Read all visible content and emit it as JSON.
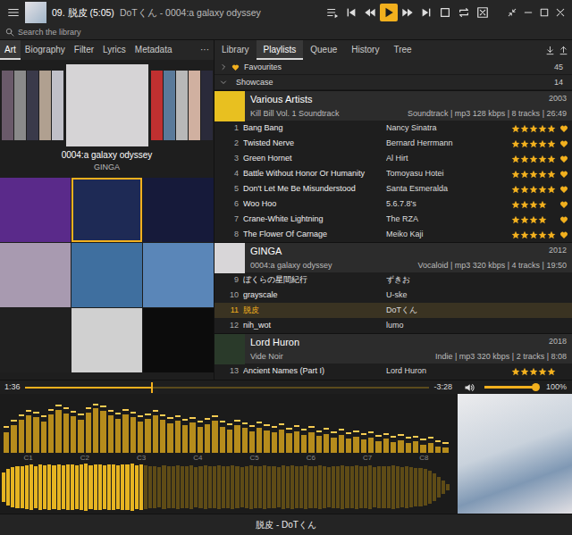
{
  "window": {
    "title": "09. 脱皮 (5:05)",
    "subtitle": "DoTくん - 0004:a galaxy odyssey"
  },
  "transport": [
    {
      "kind": "playlist",
      "selected": false
    },
    {
      "kind": "prev",
      "selected": false
    },
    {
      "kind": "rewind",
      "selected": false
    },
    {
      "kind": "play",
      "selected": true
    },
    {
      "kind": "forward",
      "selected": false
    },
    {
      "kind": "next",
      "selected": false
    },
    {
      "kind": "stop",
      "selected": false
    },
    {
      "kind": "repeat",
      "selected": false
    },
    {
      "kind": "shuffle",
      "selected": false
    }
  ],
  "window_controls": [
    {
      "kind": "mini"
    },
    {
      "kind": "minimize"
    },
    {
      "kind": "maximize"
    },
    {
      "kind": "close"
    }
  ],
  "search": {
    "placeholder": "Search the library"
  },
  "left_tabs": {
    "items": [
      {
        "label": "Art",
        "selected": true
      },
      {
        "label": "Biography",
        "selected": false
      },
      {
        "label": "Filter",
        "selected": false
      },
      {
        "label": "Lyrics",
        "selected": false
      },
      {
        "label": "Metadata",
        "selected": false
      }
    ],
    "more": "···"
  },
  "coverflow": {
    "covers": [
      {
        "color": "#6a5a6a",
        "selected": false
      },
      {
        "color": "#8a8a8a",
        "selected": false
      },
      {
        "color": "#3a3a4a",
        "selected": false
      },
      {
        "color": "#b0a090",
        "selected": false
      },
      {
        "color": "#c0c0c8",
        "selected": false
      },
      {
        "color": "#d6d4d6",
        "selected": true
      },
      {
        "color": "#c03030",
        "selected": false
      },
      {
        "color": "#5a7a9a",
        "selected": false
      },
      {
        "color": "#b8b8b8",
        "selected": false
      },
      {
        "color": "#d0b0a0",
        "selected": false
      },
      {
        "color": "#2a2a3a",
        "selected": false
      }
    ],
    "title": "0004:a galaxy odyssey",
    "artist": "GINGA"
  },
  "album_grid": [
    {
      "color": "#5a2a8a",
      "selected": false
    },
    {
      "color": "#1e2a55",
      "selected": true
    },
    {
      "color": "#161a3a",
      "selected": false
    },
    {
      "color": "#a89ab0",
      "selected": false
    },
    {
      "color": "#3f6f9f",
      "selected": false
    },
    {
      "color": "#5a86b8",
      "selected": false
    },
    {
      "color": "#202020",
      "selected": false
    },
    {
      "color": "#d0d0d0",
      "selected": false
    },
    {
      "color": "#0c0c0c",
      "selected": false
    }
  ],
  "right_tabs": [
    {
      "label": "Library",
      "selected": false
    },
    {
      "label": "Playlists",
      "selected": true
    },
    {
      "label": "Queue",
      "selected": false
    },
    {
      "label": "History",
      "selected": false
    },
    {
      "label": "Tree",
      "selected": false
    }
  ],
  "playlists": [
    {
      "name": "Favourites",
      "count": "45",
      "expanded": false,
      "favourite": true
    },
    {
      "name": "Showcase",
      "count": "14",
      "expanded": true,
      "favourite": false
    }
  ],
  "groups": [
    {
      "artist": "Various Artists",
      "album": "Kill Bill Vol. 1 Soundtrack",
      "year": "2003",
      "info": "Soundtrack | mp3 128 kbps | 8 tracks | 26:49",
      "color": "#e8c020",
      "tracks": [
        {
          "no": "1",
          "title": "Bang Bang",
          "artist": "Nancy Sinatra",
          "stars": 5,
          "loved": true,
          "selected": false
        },
        {
          "no": "2",
          "title": "Twisted Nerve",
          "artist": "Bernard Herrmann",
          "stars": 5,
          "loved": true,
          "selected": false
        },
        {
          "no": "3",
          "title": "Green Hornet",
          "artist": "Al Hirt",
          "stars": 5,
          "loved": true,
          "selected": false
        },
        {
          "no": "4",
          "title": "Battle Without Honor Or Humanity",
          "artist": "Tomoyasu Hotei",
          "stars": 5,
          "loved": true,
          "selected": false
        },
        {
          "no": "5",
          "title": "Don't Let Me Be Misunderstood",
          "artist": "Santa Esmeralda",
          "stars": 5,
          "loved": true,
          "selected": false
        },
        {
          "no": "6",
          "title": "Woo Hoo",
          "artist": "5.6.7.8's",
          "stars": 4,
          "loved": true,
          "selected": false
        },
        {
          "no": "7",
          "title": "Crane-White Lightning",
          "artist": "The RZA",
          "stars": 4,
          "loved": true,
          "selected": false
        },
        {
          "no": "8",
          "title": "The Flower Of Carnage",
          "artist": "Meiko Kaji",
          "stars": 5,
          "loved": true,
          "selected": false
        }
      ]
    },
    {
      "artist": "GINGA",
      "album": "0004:a galaxy odyssey",
      "year": "2012",
      "info": "Vocaloid | mp3 320 kbps | 4 tracks | 19:50",
      "color": "#d8d6d8",
      "tracks": [
        {
          "no": "9",
          "title": "ぼくらの星間紀行",
          "artist": "ずきお",
          "stars": 0,
          "loved": false,
          "selected": false
        },
        {
          "no": "10",
          "title": "grayscale",
          "artist": "U-ske",
          "stars": 0,
          "loved": false,
          "selected": false
        },
        {
          "no": "11",
          "title": "脱皮",
          "artist": "DoTくん",
          "stars": 0,
          "loved": false,
          "selected": true
        },
        {
          "no": "12",
          "title": "nih_wot",
          "artist": "lumo",
          "stars": 0,
          "loved": false,
          "selected": false
        }
      ]
    },
    {
      "artist": "Lord Huron",
      "album": "Vide Noir",
      "year": "2018",
      "info": "Indie | mp3 320 kbps | 2 tracks | 8:08",
      "color": "#2a3a2a",
      "tracks": [
        {
          "no": "13",
          "title": "Ancient Names (Part I)",
          "artist": "Lord Huron",
          "stars": 5,
          "loved": false,
          "selected": false
        }
      ]
    }
  ],
  "seek": {
    "elapsed": "1:36",
    "remaining": "-3:28",
    "level": 0.315
  },
  "volume": {
    "level": 1,
    "reading": "100%"
  },
  "spectrum": {
    "labels": [
      "C1",
      "C2",
      "C3",
      "C4",
      "C5",
      "C6",
      "C7",
      "C8"
    ],
    "values": [
      38,
      52,
      61,
      70,
      66,
      58,
      72,
      80,
      74,
      68,
      62,
      75,
      83,
      78,
      70,
      64,
      72,
      66,
      58,
      63,
      70,
      61,
      55,
      60,
      52,
      57,
      49,
      54,
      60,
      48,
      44,
      52,
      46,
      40,
      47,
      42,
      38,
      44,
      36,
      40,
      34,
      38,
      31,
      35,
      29,
      33,
      27,
      30,
      25,
      28,
      22,
      26,
      20,
      23,
      18,
      21,
      15,
      18,
      12,
      10
    ],
    "peaks": [
      46,
      58,
      68,
      76,
      74,
      66,
      79,
      86,
      81,
      75,
      70,
      82,
      89,
      85,
      77,
      72,
      79,
      73,
      66,
      70,
      77,
      69,
      63,
      67,
      60,
      64,
      57,
      62,
      67,
      56,
      52,
      59,
      54,
      48,
      55,
      50,
      46,
      52,
      44,
      48,
      42,
      46,
      39,
      43,
      37,
      41,
      35,
      38,
      33,
      36,
      30,
      34,
      28,
      31,
      26,
      29,
      23,
      26,
      20,
      17
    ]
  },
  "waveform": {
    "level": 0.315,
    "values": [
      0.62,
      0.78,
      0.85,
      0.9,
      0.88,
      0.93,
      0.95,
      0.9,
      0.97,
      0.92,
      0.96,
      0.94,
      0.98,
      0.93,
      0.95,
      0.97,
      0.91,
      0.96,
      0.99,
      0.94,
      0.97,
      0.95,
      0.92,
      0.98,
      0.96,
      0.93,
      0.97,
      0.95,
      0.99,
      0.94,
      0.96,
      0.92,
      0.88,
      0.9,
      0.86,
      0.91,
      0.89,
      0.87,
      0.92,
      0.9,
      0.88,
      0.91,
      0.86,
      0.9,
      0.93,
      0.89,
      0.87,
      0.91,
      0.9,
      0.88,
      0.92,
      0.89,
      0.86,
      0.9,
      0.91,
      0.87,
      0.89,
      0.92,
      0.9,
      0.88,
      0.86,
      0.91,
      0.89,
      0.93,
      0.9,
      0.87,
      0.91,
      0.88,
      0.9,
      0.92,
      0.89,
      0.86,
      0.9,
      0.88,
      0.91,
      0.87,
      0.89,
      0.92,
      0.9,
      0.88,
      0.91,
      0.86,
      0.89,
      0.9,
      0.87,
      0.91,
      0.88,
      0.85,
      0.89,
      0.86,
      0.83,
      0.8,
      0.76,
      0.7,
      0.6,
      0.45,
      0.3,
      0.15
    ]
  },
  "status_bar": "脱皮 - DoTくん"
}
